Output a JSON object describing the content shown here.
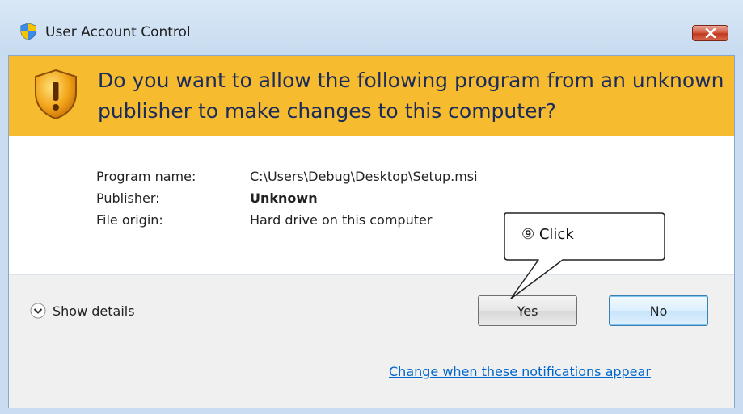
{
  "window": {
    "title": "User Account Control",
    "close_icon": "close-icon"
  },
  "banner": {
    "icon": "warning-shield-icon",
    "message": "Do you want to allow the following program from an unknown publisher to make changes to this computer?"
  },
  "info": {
    "program_name_label": "Program name:",
    "program_name_value": "C:\\Users\\Debug\\Desktop\\Setup.msi",
    "publisher_label": "Publisher:",
    "publisher_value": "Unknown",
    "file_origin_label": "File origin:",
    "file_origin_value": "Hard drive on this computer"
  },
  "callout": {
    "text": "⑨  Click"
  },
  "details": {
    "label": "Show details",
    "icon": "chevron-down-icon"
  },
  "buttons": {
    "yes": "Yes",
    "no": "No"
  },
  "footer": {
    "link": "Change when these notifications appear"
  },
  "colors": {
    "banner": "#f7bb30",
    "link": "#0066cc",
    "close": "#c1391f"
  }
}
